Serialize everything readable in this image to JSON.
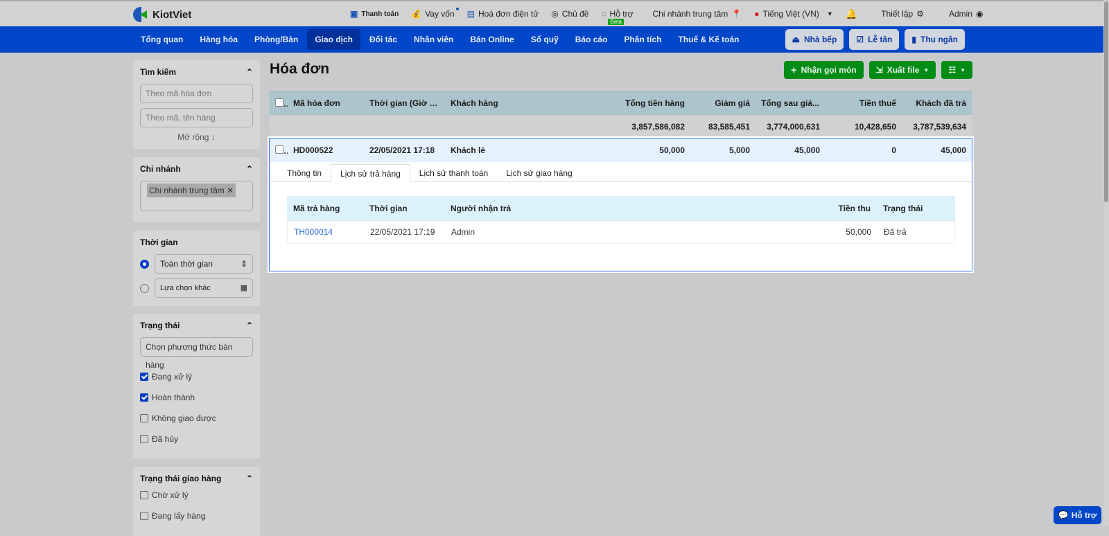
{
  "app": {
    "brand": "KiotViet"
  },
  "topbar": {
    "links": [
      {
        "icon": "payment-icon",
        "label": "Thanh toán"
      },
      {
        "icon": "money-bag-icon",
        "label": "Vay vốn"
      },
      {
        "icon": "invoice-icon",
        "label": "Hoá đơn điện tử"
      },
      {
        "icon": "palette-icon",
        "label": "Chủ đề"
      },
      {
        "icon": "chat-icon",
        "label": "Hỗ trợ",
        "badge": "Beta"
      },
      {
        "icon": "location-icon",
        "label": "Chi nhánh trung tâm"
      },
      {
        "icon": "vn-flag-icon",
        "label": "Tiếng Việt (VN)"
      },
      {
        "icon": "bell-icon",
        "label": ""
      },
      {
        "icon": "gear-icon",
        "label": "Thiết lập"
      },
      {
        "icon": "user-icon",
        "label": "Admin"
      }
    ]
  },
  "nav": {
    "items": [
      "Tổng quan",
      "Hàng hóa",
      "Phòng/Bàn",
      "Giao dịch",
      "Đối tác",
      "Nhân viên",
      "Bán Online",
      "Sổ quỹ",
      "Báo cáo",
      "Phân tích",
      "Thuế & Kế toán"
    ],
    "active": "Giao dịch",
    "buttons": [
      "Nhà bếp",
      "Lễ tân",
      "Thu ngân"
    ]
  },
  "sidebar": {
    "search": {
      "title": "Tìm kiếm",
      "placeholder1": "Theo mã hóa đơn",
      "placeholder2": "Theo mã, tên hàng",
      "more": "Mở rộng ↓"
    },
    "branch": {
      "title": "Chi nhánh",
      "tag": "Chi nhánh trung tâm"
    },
    "time": {
      "title": "Thời gian",
      "option1": "Toàn thời gian",
      "option2": "Lựa chọn khác"
    },
    "status": {
      "title": "Trạng thái",
      "select": "Chọn phương thức bán hàng",
      "items": [
        {
          "label": "Đang xử lý",
          "checked": true
        },
        {
          "label": "Hoàn thành",
          "checked": true
        },
        {
          "label": "Không giao được",
          "checked": false
        },
        {
          "label": "Đã hủy",
          "checked": false
        }
      ]
    },
    "delivery": {
      "title": "Trạng thái giao hàng",
      "items": [
        {
          "label": "Chờ xử lý",
          "checked": false
        },
        {
          "label": "Đang lấy hàng",
          "checked": false
        }
      ]
    }
  },
  "main": {
    "title": "Hóa đơn",
    "actions": {
      "order": "Nhận gọi món",
      "export": "Xuất file"
    },
    "columns": [
      "Mã hóa đơn",
      "Thời gian (Giờ đi)",
      "Khách hàng",
      "Tổng tiền hàng",
      "Giảm giá",
      "Tổng sau giá...",
      "Tiền thuế",
      "Khách đã trả"
    ],
    "totals": [
      "3,857,586,082",
      "83,585,451",
      "3,774,000,631",
      "10,428,650",
      "3,787,539,634"
    ],
    "row": [
      "HD000522",
      "22/05/2021 17:18",
      "Khách lẻ",
      "50,000",
      "5,000",
      "45,000",
      "0",
      "45,000"
    ],
    "tabs": [
      "Thông tin",
      "Lịch sử trả hàng",
      "Lịch sử thanh toán",
      "Lịch sử giao hàng"
    ],
    "active_tab": "Lịch sử trả hàng",
    "returns": {
      "columns": [
        "Mã trả hàng",
        "Thời gian",
        "Người nhận trả",
        "Tiền thu",
        "Trạng thái"
      ],
      "rows": [
        [
          "TH000014",
          "22/05/2021 17:19",
          "Admin",
          "50,000",
          "Đã trả"
        ]
      ]
    }
  },
  "support": "Hỗ trợ"
}
